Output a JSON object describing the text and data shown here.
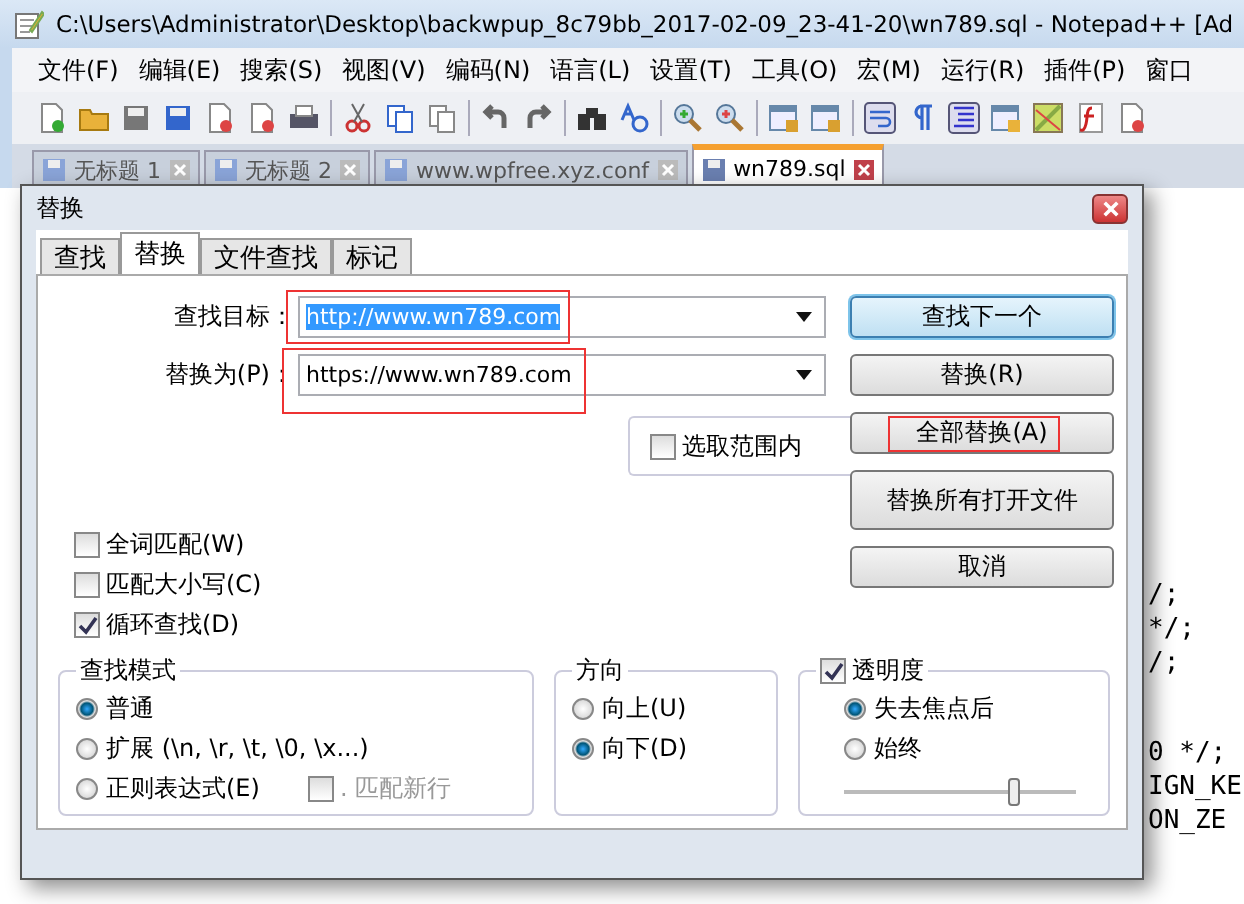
{
  "window": {
    "title": "C:\\Users\\Administrator\\Desktop\\backwpup_8c79bb_2017-02-09_23-41-20\\wn789.sql - Notepad++ [Ad"
  },
  "menu": [
    "文件(F)",
    "编辑(E)",
    "搜索(S)",
    "视图(V)",
    "编码(N)",
    "语言(L)",
    "设置(T)",
    "工具(O)",
    "宏(M)",
    "运行(R)",
    "插件(P)",
    "窗口"
  ],
  "file_tabs": [
    {
      "label": "无标题 1",
      "selected": false
    },
    {
      "label": "无标题 2",
      "selected": false
    },
    {
      "label": "www.wpfree.xyz.conf",
      "selected": false
    },
    {
      "label": "wn789.sql",
      "selected": true
    }
  ],
  "editor": {
    "lines_upper": [
      "/;",
      "*/;",
      "/;"
    ],
    "lines_lower": [
      "0 */;",
      "IGN_KE",
      "ON_ZE"
    ]
  },
  "dialog": {
    "title": "替换",
    "tabs": [
      {
        "label": "查找",
        "selected": false
      },
      {
        "label": "替换",
        "selected": true
      },
      {
        "label": "文件查找",
        "selected": false
      },
      {
        "label": "标记",
        "selected": false
      }
    ],
    "find": {
      "label": "查找目标：",
      "value": "http://www.wn789.com",
      "text_selected": true,
      "highlighted": true
    },
    "replace": {
      "label": "替换为(P)：",
      "value": "https://www.wn789.com",
      "text_selected": false,
      "highlighted": true
    },
    "in_selection": {
      "label": "选取范围内",
      "checked": false
    },
    "buttons": [
      {
        "label": "查找下一个",
        "default": true,
        "highlighted": false
      },
      {
        "label": "替换(R)",
        "default": false,
        "highlighted": false
      },
      {
        "label": "全部替换(A)",
        "default": false,
        "highlighted": true
      },
      {
        "label": "替换所有打开文件",
        "default": false,
        "highlighted": false
      },
      {
        "label": "取消",
        "default": false,
        "highlighted": false
      }
    ],
    "options": [
      {
        "label": "全词匹配(W)",
        "checked": false
      },
      {
        "label": "匹配大小写(C)",
        "checked": false
      },
      {
        "label": "循环查找(D)",
        "checked": true
      }
    ],
    "search_mode": {
      "title": "查找模式",
      "options": [
        {
          "label": "普通",
          "selected": true
        },
        {
          "label": "扩展 (\\n, \\r, \\t, \\0, \\x...)",
          "selected": false
        },
        {
          "label": "正则表达式(E)",
          "selected": false
        }
      ],
      "dot_newline": {
        "label": ". 匹配新行",
        "checked": false,
        "disabled": true
      }
    },
    "direction": {
      "title": "方向",
      "options": [
        {
          "label": "向上(U)",
          "selected": false
        },
        {
          "label": "向下(D)",
          "selected": true
        }
      ]
    },
    "transparency": {
      "label": "透明度",
      "checked": true,
      "options": [
        {
          "label": "失去焦点后",
          "selected": true
        },
        {
          "label": "始终",
          "selected": false
        }
      ],
      "level": 0.72
    }
  }
}
